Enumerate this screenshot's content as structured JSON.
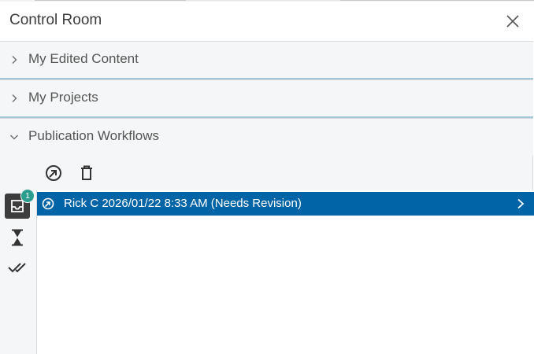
{
  "panel": {
    "title": "Control Room"
  },
  "sections": [
    {
      "label": "My Edited Content",
      "expanded": false
    },
    {
      "label": "My Projects",
      "expanded": false
    },
    {
      "label": "Publication Workflows",
      "expanded": true
    }
  ],
  "toolbar": {
    "icons": [
      "publish-icon",
      "trash-icon"
    ]
  },
  "rail": {
    "inbox_badge": "1",
    "icons": [
      "inbox-icon",
      "hourglass-icon",
      "double-check-icon"
    ]
  },
  "workflows": [
    {
      "text": "Rick C 2026/01/22 8:33 AM (Needs Revision)",
      "selected": true,
      "icon": "publish-icon"
    }
  ],
  "colors": {
    "selected_row": "#0064a6",
    "badge": "#2a9d8f",
    "section_divider": "#9fc7d6"
  }
}
